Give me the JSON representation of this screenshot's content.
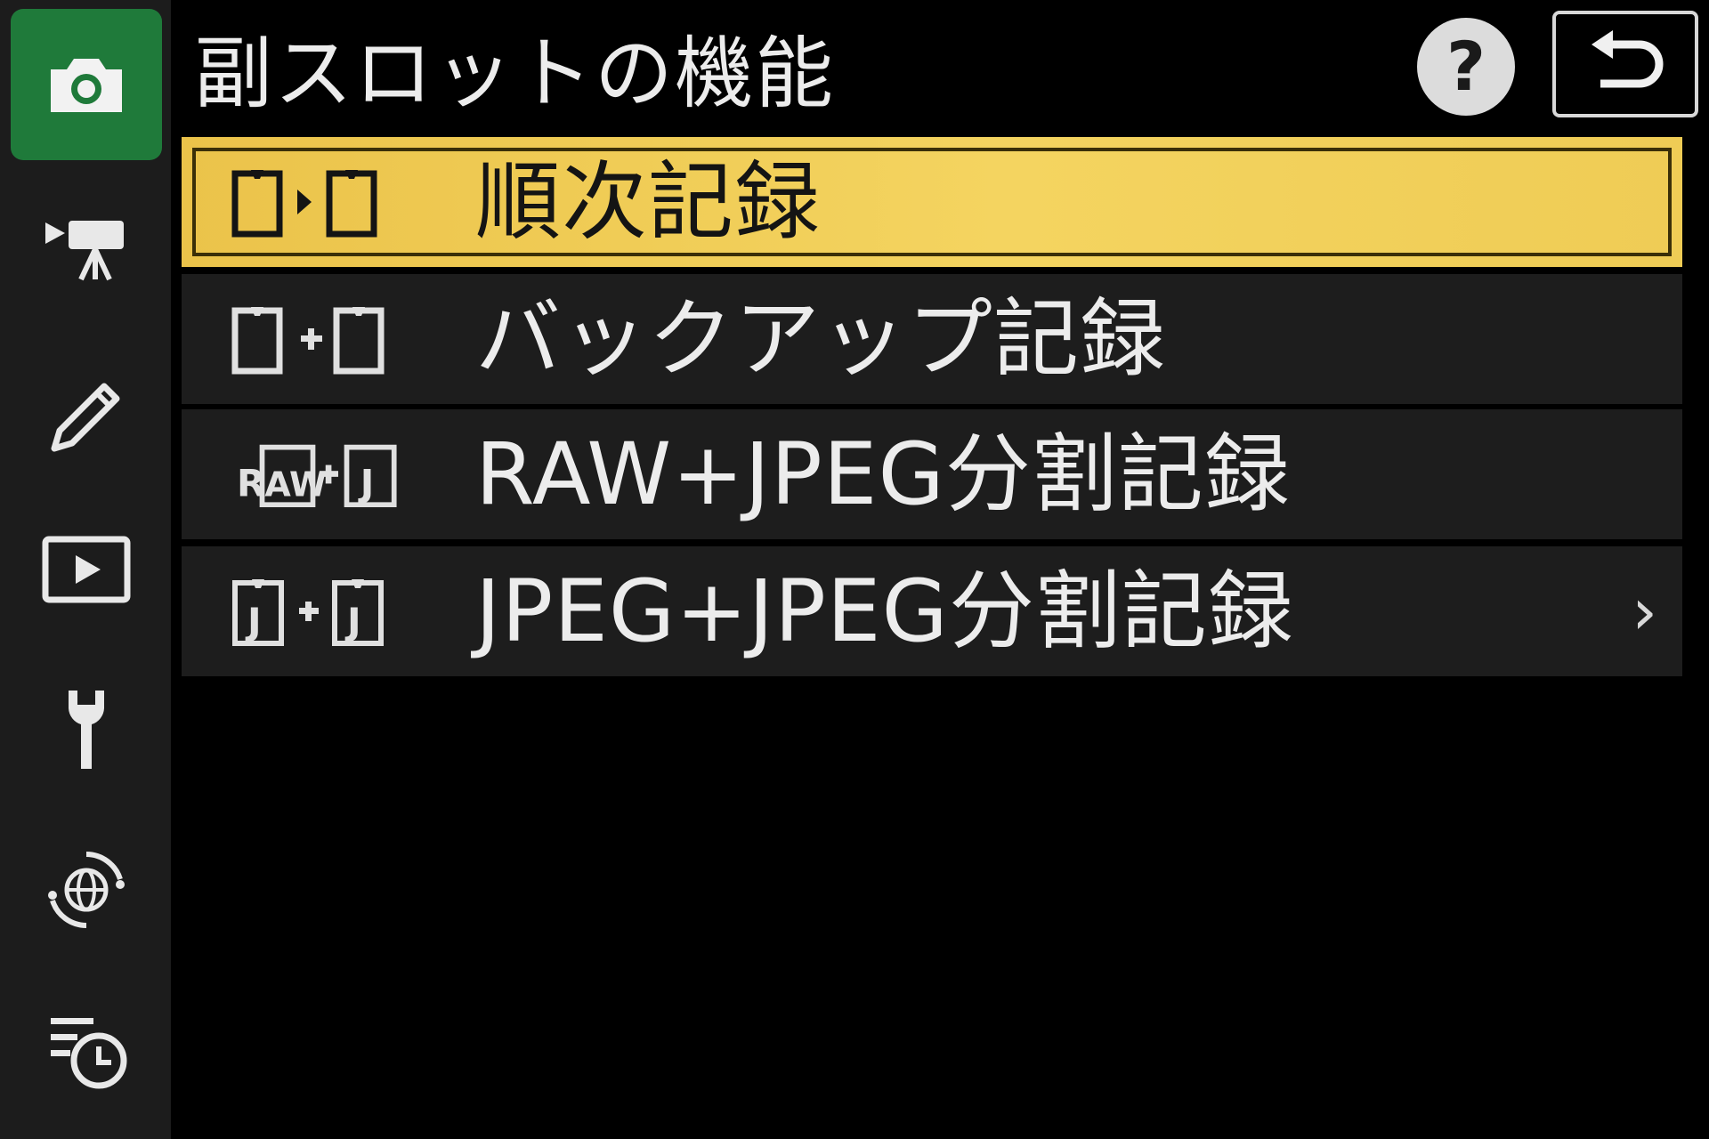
{
  "header": {
    "title": "副スロットの機能",
    "help_label": "?"
  },
  "sidebar": {
    "tabs": [
      {
        "icon": "camera-icon",
        "active": true
      },
      {
        "icon": "movie-camera-icon",
        "active": false
      },
      {
        "icon": "pencil-icon",
        "active": false
      },
      {
        "icon": "playback-icon",
        "active": false
      },
      {
        "icon": "wrench-icon",
        "active": false
      },
      {
        "icon": "network-globe-icon",
        "active": false
      },
      {
        "icon": "recent-settings-clock-icon",
        "active": false
      }
    ]
  },
  "menu": {
    "items": [
      {
        "label": "順次記録",
        "icon": "overflow-slot-icon",
        "selected": true,
        "has_arrow": false
      },
      {
        "label": "バックアップ記録",
        "icon": "backup-slot-icon",
        "selected": false,
        "has_arrow": false
      },
      {
        "label": "RAW+JPEG分割記録",
        "icon": "raw-jpeg-slot-icon",
        "selected": false,
        "has_arrow": false
      },
      {
        "label": "JPEG+JPEG分割記録",
        "icon": "jpeg-jpeg-slot-icon",
        "selected": false,
        "has_arrow": true,
        "arrow": "›"
      }
    ]
  },
  "colors": {
    "active_tab": "#1f7a3a",
    "selected_row": "#f1cf57",
    "row_bg": "#1d1d1d",
    "sidebar_bg": "#1c1c1c",
    "text": "#ececec"
  }
}
